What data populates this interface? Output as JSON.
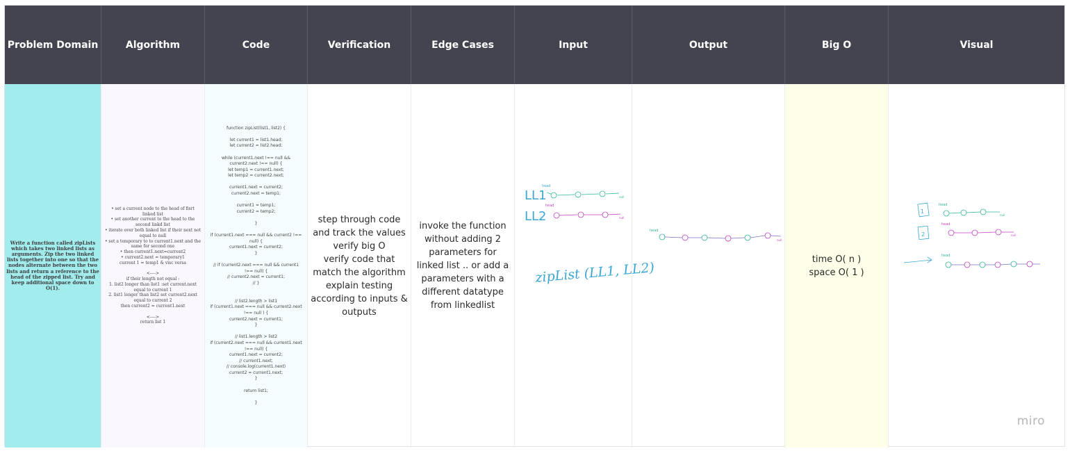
{
  "headers": [
    "Problem Domain",
    "Algorithm",
    "Code",
    "Verification",
    "Edge Cases",
    "Input",
    "Output",
    "Big O",
    "Visual"
  ],
  "problem_text": "Write a function called zipLists which takes two linked lists as arguments. Zip the two linked lists together into one so that the nodes alternate between the two lists and return a reference to the head of the zipped list. Try and keep additional space down to O(1).",
  "algorithm_text": "• set a current node to the head of fisrt linked list\n• set another current to the head to the second linkd list\n• iterate over both linked list if their next not equal to null\n• set a temporary to to current1.next and the same for second one\n• then current1.next=current2\n• current2.next = temporary1\ncurrent 1 = temp1 & visc versa\n\n<---->\nif their length not equal :\n1. list2 longer than list1 :set current.next equal to current 1\n2. list1 longer than list2 set current2.next equal to current 2\nthen current2 = current1.next\n\n<---->\nreturn list 1",
  "code_text": "function zipList(list1, list2) {\n\nlet current1 = list1.head;\nlet current2 = list2.head;\n\nwhile (current1.next !== null && current2.next !== null) {\nlet temp1 = current1.next;\nlet temp2 = current2.next;\n\ncurrent1.next = current2;\ncurrent2.next = temp1;\n\ncurrent1 = temp1;\ncurrent2 = temp2;\n\n}\n\nif (current1.next === null && current2 !== null) {\ncurrent1.next = current2;\n}\n\n// if (current2.next === null && current1 !== null) {\n//   current2.next = current1;\n// }\n\n\n// list2.length > list1\nif (current1.next === null && current2.next !== null ) {\ncurrent2.next = current1;\n}\n\n// list1.length > list2\nif (current2.next === null && current1.next !== null) {\ncurrent1.next = current2;\n// current1.next;\n// console.log(current1.next)\ncurrent2 = current1.next;\n}\n\nreturn list1;\n\n}",
  "verification_text": "step through code and track the values\nverify big O\nverify code that match the algorithm\nexplain testing according to inputs & outputs",
  "edge_cases_text": "invoke the function without adding 2 parameters for linked list .. or add a parameters with a different datatype from linkedlist",
  "big_o": {
    "time": "time O( n )",
    "space": "space O( 1 )"
  },
  "input_sketch": {
    "label_ll1": "LL1",
    "label_ll2": "LL2",
    "call": "zipList (LL1, LL2)",
    "head": "head",
    "null": "null"
  },
  "output_sketch": {
    "head": "head",
    "null": "null"
  },
  "visual_sketch": {
    "label_1": "1",
    "label_2": "2",
    "head": "head",
    "null": "null"
  },
  "watermark": "miro",
  "colors": {
    "header_bg": "#434450",
    "problem_bg": "#a2ecee",
    "algo_bg": "#fbf7fe",
    "code_bg": "#f5fcfe",
    "bigo_bg": "#fffee8",
    "ink_blue": "#3aa6d4",
    "ink_green": "#2fb59a",
    "ink_pink": "#c33fc2"
  }
}
